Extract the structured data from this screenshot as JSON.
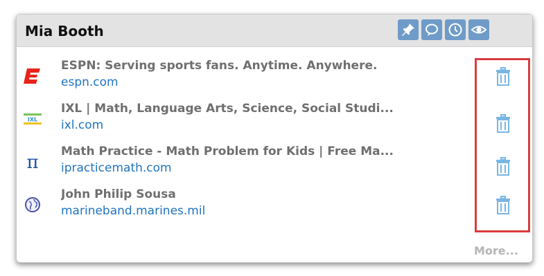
{
  "panel": {
    "title": "Mia Booth",
    "header_icons": [
      "pin-icon",
      "speech-bubble-icon",
      "clock-icon",
      "eye-icon"
    ],
    "accent_color": "#6f9bc8"
  },
  "sites": [
    {
      "title": "ESPN: Serving sports fans. Anytime. Anywhere.",
      "url": "espn.com",
      "icon": "espn-logo-icon"
    },
    {
      "title": "IXL | Math, Language Arts, Science, Social Studi...",
      "url": "ixl.com",
      "icon": "ixl-logo-icon"
    },
    {
      "title": "Math Practice - Math Problem for Kids | Free Ma...",
      "url": "ipracticemath.com",
      "icon": "pi-icon"
    },
    {
      "title": "John Philip Sousa",
      "url": "marineband.marines.mil",
      "icon": "globe-icon"
    }
  ],
  "delete_icon": "trash-icon",
  "highlight_color": "#d93b3b",
  "more_label": "More..."
}
